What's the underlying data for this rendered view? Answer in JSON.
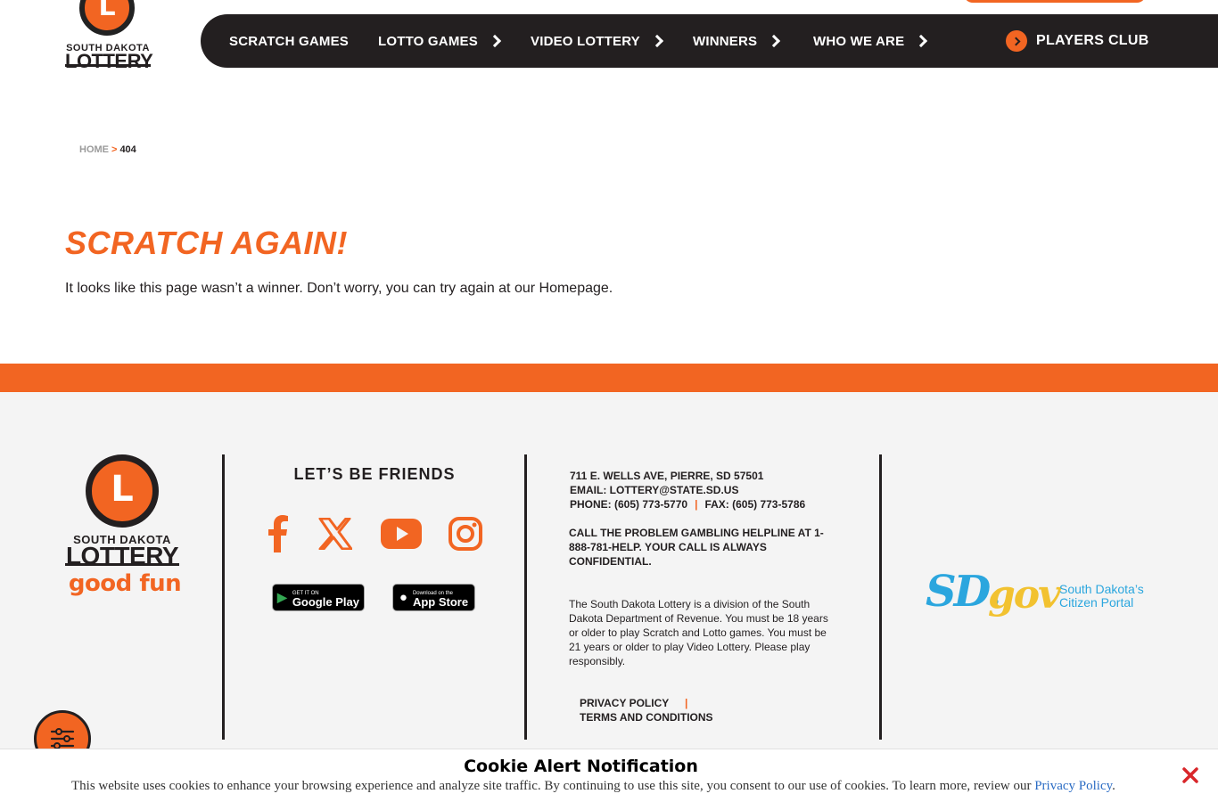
{
  "header": {
    "logo": {
      "line1": "SOUTH DAKOTA",
      "line2": "LOTTERY",
      "glyph": "L"
    },
    "nav": [
      {
        "label": "SCRATCH GAMES",
        "has_chevron": false
      },
      {
        "label": "LOTTO GAMES",
        "has_chevron": true
      },
      {
        "label": "VIDEO LOTTERY",
        "has_chevron": true
      },
      {
        "label": "WINNERS",
        "has_chevron": true
      },
      {
        "label": "WHO WE ARE",
        "has_chevron": true
      }
    ],
    "players_club": "PLAYERS CLUB"
  },
  "breadcrumb": {
    "home": "HOME",
    "separator": ">",
    "current": "404"
  },
  "main": {
    "title": "SCRATCH AGAIN!",
    "description": "It looks like this page wasn’t a winner. Don’t worry, you can try again at our Homepage."
  },
  "footer": {
    "logo": {
      "line1": "SOUTH DAKOTA",
      "line2": "LOTTERY",
      "tagline": "good fun",
      "glyph": "L"
    },
    "friends_title": "LET’S BE FRIENDS",
    "social_icons": [
      "facebook-icon",
      "x-icon",
      "youtube-icon",
      "instagram-icon"
    ],
    "stores": {
      "google": "Google Play",
      "apple": "App Store",
      "google_small": "GET IT ON",
      "apple_small": "Download on the"
    },
    "address": "711 E. WELLS AVE, PIERRE, SD 57501",
    "email": "EMAIL: LOTTERY@STATE.SD.US",
    "phone": "PHONE: (605) 773-5770",
    "fax": "FAX: (605) 773-5786",
    "helpline": "CALL THE PROBLEM GAMBLING HELPLINE AT 1-888-781-HELP. YOUR CALL IS ALWAYS CONFIDENTIAL.",
    "disclaimer": "The South Dakota Lottery is a division of the South Dakota Department of Revenue. You must be 18 years or older to play Scratch and Lotto games. You must be 21 years or older to play Video Lottery. Please play responsibly.",
    "privacy": "PRIVACY POLICY",
    "terms": "TERMS AND CONDITIONS",
    "sdgov": {
      "sd": "SD.",
      "gov": "gov",
      "portal1": "South Dakota’s",
      "portal2": "Citizen Portal"
    }
  },
  "cookie": {
    "title": "Cookie Alert Notification",
    "text": "This website uses cookies to enhance your browsing experience and analyze site traffic. By continuing to use this site, you consent to our use of cookies. To learn more, review our",
    "link": "Privacy Policy",
    "end": "."
  },
  "colors": {
    "accent": "#f26522",
    "dark": "#231f20",
    "footer_bg": "#f4f4f4",
    "link": "#2b6cc4"
  }
}
